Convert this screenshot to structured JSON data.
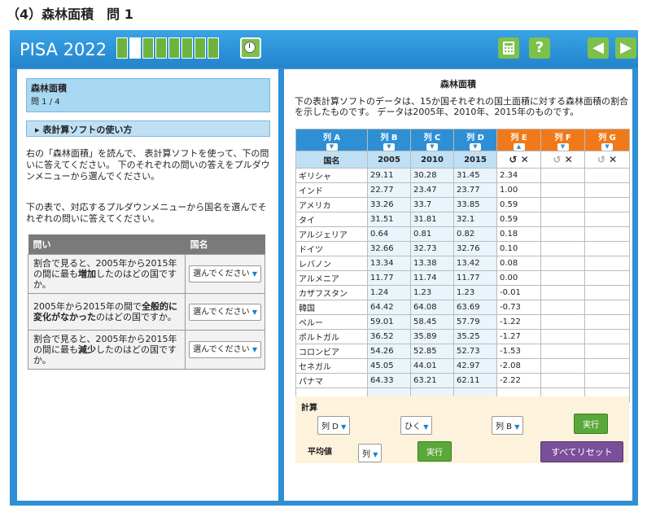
{
  "page_title": "（4）森林面積　問 1",
  "topbar": {
    "title": "PISA 2022",
    "progress": {
      "total": 8,
      "current": 2
    },
    "calculator_icon": "calculator-icon",
    "help_label": "?",
    "prev_label": "◀",
    "next_label": "▶"
  },
  "left": {
    "unit_title": "森林面積",
    "unit_question": "問 1 / 4",
    "howto_label": "▸ 表計算ソフトの使い方",
    "instruction1": "右の「森林面積」を読んで、 表計算ソフトを使って、下の問いに答えてください。 下のそれぞれの問いの答えをプルダウンメニューから選んでください。",
    "instruction2": "下の表で、対応するプルダウンメニューから国名を選んでそれぞれの問いに答えてください。",
    "table_headers": [
      "問い",
      "国名"
    ],
    "questions": [
      {
        "pre": "割合で見ると、2005年から2015年の間に最も",
        "bold": "増加",
        "post": "したのはどの国ですか。",
        "select": "選んでください"
      },
      {
        "pre": "2005年から2015年の間で",
        "bold": "全般的に変化がなかった",
        "post": "のはどの国ですか。",
        "select": "選んでください"
      },
      {
        "pre": "割合で見ると、2005年から2015年の間に最も",
        "bold": "減少",
        "post": "したのはどの国ですか。",
        "select": "選んでください"
      }
    ]
  },
  "right": {
    "title": "森林面積",
    "description": "下の表計算ソフトのデータは、15か国それぞれの国土面積に対する森林面積の割合を示したものです。 データは2005年、2010年、2015年のものです。",
    "columns": [
      "列 A",
      "列 B",
      "列 C",
      "列 D",
      "列 E",
      "列 F",
      "列 G"
    ],
    "subheaders": [
      "国名",
      "2005",
      "2010",
      "2015"
    ],
    "rows": [
      [
        "ギリシャ",
        "29.11",
        "30.28",
        "31.45",
        "2.34"
      ],
      [
        "インド",
        "22.77",
        "23.47",
        "23.77",
        "1.00"
      ],
      [
        "アメリカ",
        "33.26",
        "33.7",
        "33.85",
        "0.59"
      ],
      [
        "タイ",
        "31.51",
        "31.81",
        "32.1",
        "0.59"
      ],
      [
        "アルジェリア",
        "0.64",
        "0.81",
        "0.82",
        "0.18"
      ],
      [
        "ドイツ",
        "32.66",
        "32.73",
        "32.76",
        "0.10"
      ],
      [
        "レバノン",
        "13.34",
        "13.38",
        "13.42",
        "0.08"
      ],
      [
        "アルメニア",
        "11.77",
        "11.74",
        "11.77",
        "0.00"
      ],
      [
        "カザフスタン",
        "1.24",
        "1.23",
        "1.23",
        "-0.01"
      ],
      [
        "韓国",
        "64.42",
        "64.08",
        "63.69",
        "-0.73"
      ],
      [
        "ペルー",
        "59.01",
        "58.45",
        "57.79",
        "-1.22"
      ],
      [
        "ポルトガル",
        "36.52",
        "35.89",
        "35.25",
        "-1.27"
      ],
      [
        "コロンビア",
        "54.26",
        "52.85",
        "52.73",
        "-1.53"
      ],
      [
        "セネガル",
        "45.05",
        "44.01",
        "42.97",
        "-2.08"
      ],
      [
        "パナマ",
        "64.33",
        "63.21",
        "62.11",
        "-2.22"
      ]
    ],
    "calc": {
      "label": "計算",
      "col1": "列 D",
      "op": "ひく",
      "col2": "列 B",
      "run": "実行"
    },
    "avg": {
      "label": "平均値",
      "col": "列",
      "run": "実行",
      "reset": "すべてリセット"
    }
  }
}
